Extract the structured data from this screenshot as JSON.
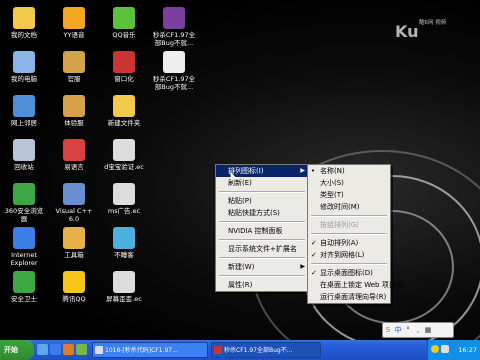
{
  "desktop": {
    "icons": [
      {
        "label": "我的文档",
        "icon": "folder-icon",
        "color": "#f2c94c"
      },
      {
        "label": "YY语音",
        "icon": "yy-icon",
        "color": "#f5a623"
      },
      {
        "label": "QQ音乐",
        "icon": "music-icon",
        "color": "#5cc13b"
      },
      {
        "label": "秒杀CF1.97全\n部Bug不就...",
        "icon": "archive-icon",
        "color": "#7b3fa0"
      },
      {
        "label": "我的电脑",
        "icon": "computer-icon",
        "color": "#8ab4e8"
      },
      {
        "label": "官服",
        "icon": "game-icon",
        "color": "#d4a24a"
      },
      {
        "label": "窗口化",
        "icon": "window-icon",
        "color": "#cc3333"
      },
      {
        "label": "秒杀CF1.97全\n部Bug不就...",
        "icon": "document-icon",
        "color": "#eeeeee"
      },
      {
        "label": "网上邻居",
        "icon": "network-icon",
        "color": "#4f8fd8"
      },
      {
        "label": "体验服",
        "icon": "game-icon",
        "color": "#d4a24a"
      },
      {
        "label": "新建文件夹",
        "icon": "folder-icon",
        "color": "#f2c94c"
      },
      {
        "label": "回收站",
        "icon": "recycle-bin-icon",
        "color": "#b7c4d8"
      },
      {
        "label": "易语言",
        "icon": "app-icon",
        "color": "#d94141"
      },
      {
        "label": "d宝宝验证.ec",
        "icon": "file-icon",
        "color": "#dddddd"
      },
      {
        "label": "360安全浏览\n器",
        "icon": "browser-icon",
        "color": "#3da745"
      },
      {
        "label": "Visual C++ 6.0",
        "icon": "vc-icon",
        "color": "#6a8fd0"
      },
      {
        "label": "ms广告.ec",
        "icon": "file-icon",
        "color": "#dddddd"
      },
      {
        "label": "Internet\nExplorer",
        "icon": "ie-icon",
        "color": "#3a7ee6"
      },
      {
        "label": "工具箱",
        "icon": "toolbox-icon",
        "color": "#e8b04a"
      },
      {
        "label": "不睡客",
        "icon": "app-icon",
        "color": "#4bb0e0"
      },
      {
        "label": "安全卫士",
        "icon": "shield-icon",
        "color": "#3da745"
      },
      {
        "label": "腾讯QQ",
        "icon": "qq-icon",
        "color": "#f5c518"
      },
      {
        "label": "屏幕歪歪.ec",
        "icon": "file-icon",
        "color": "#dddddd"
      }
    ]
  },
  "context_menu": {
    "items": [
      {
        "label": "排列图标(I)",
        "submenu": true,
        "highlighted": true
      },
      {
        "label": "刷新(E)"
      },
      {
        "label": "粘贴(P)"
      },
      {
        "label": "粘贴快捷方式(S)"
      },
      {
        "label": "NVIDIA 控制面板"
      },
      {
        "label": "显示系统文件+扩展名"
      },
      {
        "label": "新建(W)",
        "submenu": true
      },
      {
        "label": "属性(R)"
      }
    ]
  },
  "submenu": {
    "items": [
      {
        "label": "名称(N)",
        "checked": true
      },
      {
        "label": "大小(S)"
      },
      {
        "label": "类型(T)"
      },
      {
        "label": "修改时间(M)"
      },
      {
        "label": "按组排列(G)",
        "disabled": true
      },
      {
        "label": "自动排列(A)",
        "checked": true
      },
      {
        "label": "对齐到网格(L)",
        "checked": true
      },
      {
        "label": "显示桌面图标(D)",
        "checked": true
      },
      {
        "label": "在桌面上锁定 Web 项目(I)"
      },
      {
        "label": "运行桌面清理向导(R)"
      }
    ]
  },
  "taskbar": {
    "start_label": "开始",
    "buttons": [
      {
        "label": "1018-[秒杀代码]CF1.97..."
      },
      {
        "label": "秒杀CF1.97全部Bug不..."
      }
    ],
    "clock": "16:27"
  },
  "ime": {
    "items": [
      "S",
      "中",
      "°",
      ",",
      "▦"
    ]
  },
  "watermark": {
    "brand": "Ku",
    "sub": "酷6网 视频"
  }
}
